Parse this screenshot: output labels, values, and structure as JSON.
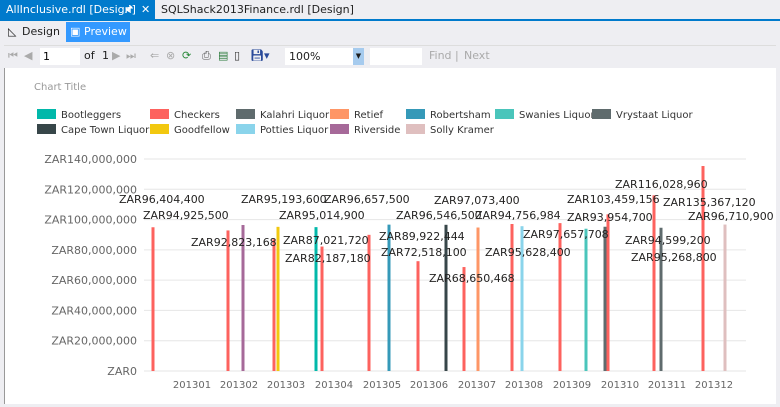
{
  "tabs": [
    {
      "label": "AllInclusive.rdl [Design]",
      "active": true
    },
    {
      "label": "SQLShack2013Finance.rdl [Design]",
      "active": false
    }
  ],
  "modes": {
    "design": "Design",
    "preview": "Preview"
  },
  "toolbar": {
    "page": "1",
    "of_label": "of",
    "total_pages": "1",
    "zoom": "100%",
    "find": "Find",
    "separator": "|",
    "next": "Next"
  },
  "chart_data": {
    "type": "bar",
    "title": "Chart Title",
    "categories": [
      "201301",
      "201302",
      "201303",
      "201304",
      "201305",
      "201306",
      "201307",
      "201308",
      "201309",
      "201310",
      "201311",
      "201312"
    ],
    "yticks": [
      "ZAR0",
      "ZAR20,000,000",
      "ZAR40,000,000",
      "ZAR60,000,000",
      "ZAR80,000,000",
      "ZAR100,000,000",
      "ZAR120,000,000",
      "ZAR140,000,000"
    ],
    "ylim": [
      0,
      140000000
    ],
    "grid": true,
    "legend_position": "top",
    "legend": [
      {
        "name": "Bootleggers",
        "color": "#01b8aa"
      },
      {
        "name": "Checkers",
        "color": "#fd625e"
      },
      {
        "name": "Kalahri Liquor",
        "color": "#5f6b6d"
      },
      {
        "name": "Retief",
        "color": "#fe9666"
      },
      {
        "name": "Robertsham",
        "color": "#3599b8"
      },
      {
        "name": "Swanies Liquor",
        "color": "#4ac5bb"
      },
      {
        "name": "Vrystaat Liquor",
        "color": "#5f6b6d"
      },
      {
        "name": "Cape Town Liquor",
        "color": "#374649"
      },
      {
        "name": "Goodfellow",
        "color": "#f2c80f"
      },
      {
        "name": "Potties Liquor",
        "color": "#8ad4eb"
      },
      {
        "name": "Riverside",
        "color": "#a66999"
      },
      {
        "name": "Solly Kramer",
        "color": "#dfbfbf"
      }
    ],
    "points": [
      {
        "category": "201301",
        "series": "Checkers",
        "value": 94925500,
        "label": "ZAR94,925,500"
      },
      {
        "category": "201302",
        "series": "Checkers",
        "value": 92823168,
        "label": "ZAR92,823,168"
      },
      {
        "category": "201302",
        "series": "Riverside",
        "value": 96404400,
        "label": "ZAR96,404,400"
      },
      {
        "category": "201303",
        "series": "Checkers",
        "value": 87021720,
        "label": "ZAR87,021,720"
      },
      {
        "category": "201303",
        "series": "Goodfellow",
        "value": 95193600,
        "label": "ZAR95,193,600"
      },
      {
        "category": "201304",
        "series": "Bootleggers",
        "value": 95014900,
        "label": "ZAR95,014,900"
      },
      {
        "category": "201304",
        "series": "Checkers",
        "value": 82187180,
        "label": "ZAR82,187,180"
      },
      {
        "category": "201305",
        "series": "Checkers",
        "value": 89922444,
        "label": "ZAR89,922,444"
      },
      {
        "category": "201305",
        "series": "Robertsham",
        "value": 96657500,
        "label": "ZAR96,657,500"
      },
      {
        "category": "201306",
        "series": "Checkers",
        "value": 72518100,
        "label": "ZAR72,518,100"
      },
      {
        "category": "201306",
        "series": "Cape Town Liquor",
        "value": 96546500,
        "label": "ZAR96,546,500"
      },
      {
        "category": "201307",
        "series": "Checkers",
        "value": 68650468,
        "label": "ZAR68,650,468"
      },
      {
        "category": "201307",
        "series": "Retief",
        "value": 94756984,
        "label": "ZAR94,756,984"
      },
      {
        "category": "201308",
        "series": "Checkers",
        "value": 97073400,
        "label": "ZAR97,073,400"
      },
      {
        "category": "201308",
        "series": "Potties Liquor",
        "value": 95628400,
        "label": "ZAR95,628,400"
      },
      {
        "category": "201309",
        "series": "Checkers",
        "value": 97657708,
        "label": "ZAR97,657,708"
      },
      {
        "category": "201309",
        "series": "Swanies Liquor",
        "value": 93954700,
        "label": "ZAR93,954,700"
      },
      {
        "category": "201310",
        "series": "Vrystaat Liquor",
        "value": 95268800,
        "label": "ZAR95,268,800"
      },
      {
        "category": "201310",
        "series": "Checkers",
        "value": 103459156,
        "label": "ZAR103,459,156"
      },
      {
        "category": "201311",
        "series": "Checkers",
        "value": 116028960,
        "label": "ZAR116,028,960"
      },
      {
        "category": "201311",
        "series": "Vrystaat Liquor",
        "value": 94599200,
        "label": "ZAR94,599,200"
      },
      {
        "category": "201312",
        "series": "Checkers",
        "value": 135367120,
        "label": "ZAR135,367,120"
      },
      {
        "category": "201312",
        "series": "Solly Kramer",
        "value": 96710900,
        "label": "ZAR96,710,900"
      }
    ]
  }
}
